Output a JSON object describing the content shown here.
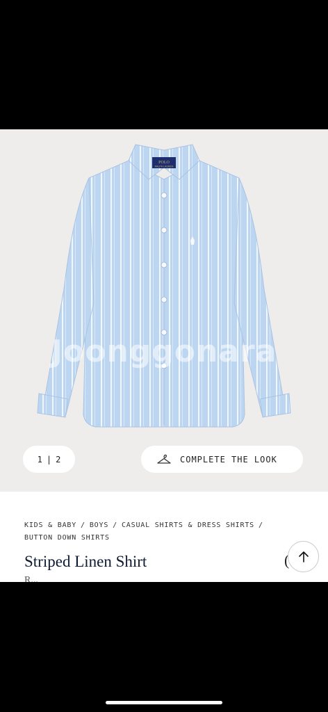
{
  "gallery": {
    "watermark": "Joonggonara",
    "label_brand": "POLO",
    "label_sub": "RALPH LAUREN",
    "pager": {
      "current": "1",
      "separator": "|",
      "total": "2"
    },
    "complete_look_label": "COMPLETE THE LOOK"
  },
  "product": {
    "breadcrumb": [
      "KIDS & BABY",
      "BOYS",
      "CASUAL SHIRTS & DRESS SHIRTS",
      "BUTTON DOWN SHIRTS"
    ],
    "breadcrumb_separator": "/",
    "title": "Striped Linen Shirt",
    "price": "R...",
    "edge_glyph": "("
  },
  "colors": {
    "shirt": "#bcd5f1",
    "stripe": "#f4f8fd",
    "background": "#efedeb",
    "title": "#0e1b33"
  }
}
